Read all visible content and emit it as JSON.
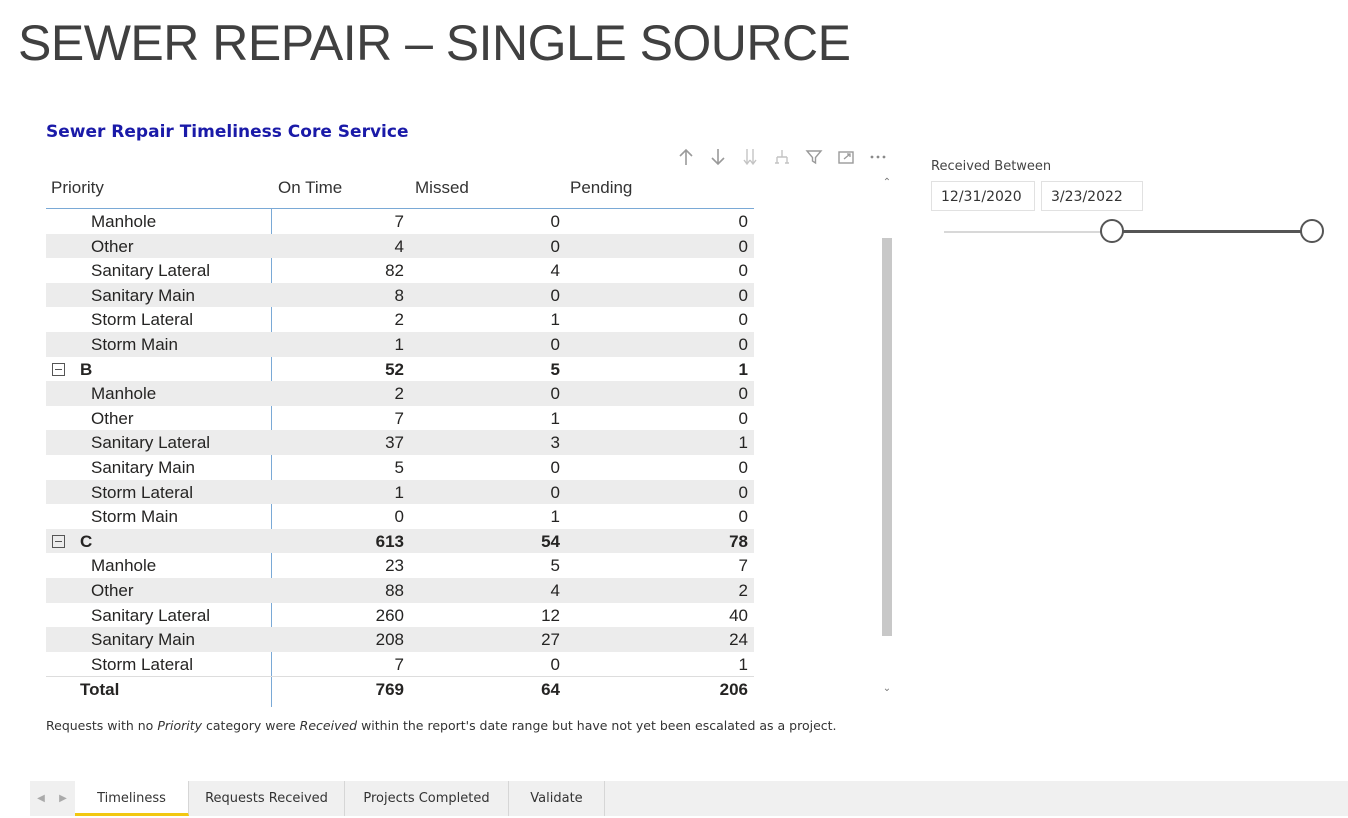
{
  "page_title": "SEWER REPAIR – SINGLE SOURCE",
  "visual": {
    "title": "Sewer Repair Timeliness Core Service",
    "icons": [
      "arrow-up-icon",
      "arrow-down-icon",
      "double-arrow-down-icon",
      "expand-hierarchy-icon",
      "filter-icon",
      "focus-mode-icon",
      "more-options-icon"
    ]
  },
  "matrix": {
    "columns": [
      "Priority",
      "On Time",
      "Missed",
      "Pending"
    ],
    "rows": [
      {
        "label": "Manhole",
        "on_time": "7",
        "missed": "0",
        "pending": "0",
        "group": false
      },
      {
        "label": "Other",
        "on_time": "4",
        "missed": "0",
        "pending": "0",
        "group": false
      },
      {
        "label": "Sanitary Lateral",
        "on_time": "82",
        "missed": "4",
        "pending": "0",
        "group": false
      },
      {
        "label": "Sanitary Main",
        "on_time": "8",
        "missed": "0",
        "pending": "0",
        "group": false
      },
      {
        "label": "Storm Lateral",
        "on_time": "2",
        "missed": "1",
        "pending": "0",
        "group": false
      },
      {
        "label": "Storm Main",
        "on_time": "1",
        "missed": "0",
        "pending": "0",
        "group": false
      },
      {
        "label": "B",
        "on_time": "52",
        "missed": "5",
        "pending": "1",
        "group": true
      },
      {
        "label": "Manhole",
        "on_time": "2",
        "missed": "0",
        "pending": "0",
        "group": false
      },
      {
        "label": "Other",
        "on_time": "7",
        "missed": "1",
        "pending": "0",
        "group": false
      },
      {
        "label": "Sanitary Lateral",
        "on_time": "37",
        "missed": "3",
        "pending": "1",
        "group": false
      },
      {
        "label": "Sanitary Main",
        "on_time": "5",
        "missed": "0",
        "pending": "0",
        "group": false
      },
      {
        "label": "Storm Lateral",
        "on_time": "1",
        "missed": "0",
        "pending": "0",
        "group": false
      },
      {
        "label": "Storm Main",
        "on_time": "0",
        "missed": "1",
        "pending": "0",
        "group": false
      },
      {
        "label": "C",
        "on_time": "613",
        "missed": "54",
        "pending": "78",
        "group": true
      },
      {
        "label": "Manhole",
        "on_time": "23",
        "missed": "5",
        "pending": "7",
        "group": false
      },
      {
        "label": "Other",
        "on_time": "88",
        "missed": "4",
        "pending": "2",
        "group": false
      },
      {
        "label": "Sanitary Lateral",
        "on_time": "260",
        "missed": "12",
        "pending": "40",
        "group": false
      },
      {
        "label": "Sanitary Main",
        "on_time": "208",
        "missed": "27",
        "pending": "24",
        "group": false
      },
      {
        "label": "Storm Lateral",
        "on_time": "7",
        "missed": "0",
        "pending": "1",
        "group": false
      }
    ],
    "total": {
      "label": "Total",
      "on_time": "769",
      "missed": "64",
      "pending": "206"
    }
  },
  "footnote": {
    "part1": "Requests with no ",
    "em1": "Priority",
    "part2": " category were ",
    "em2": "Received",
    "part3": " within the report's date range but have not yet been escalated as a project."
  },
  "slicer": {
    "title": "Received Between",
    "start_date": "12/31/2020",
    "end_date": "3/23/2022"
  },
  "tabs": [
    "Timeliness",
    "Requests Received",
    "Projects Completed",
    "Validate"
  ],
  "active_tab": "Timeliness"
}
